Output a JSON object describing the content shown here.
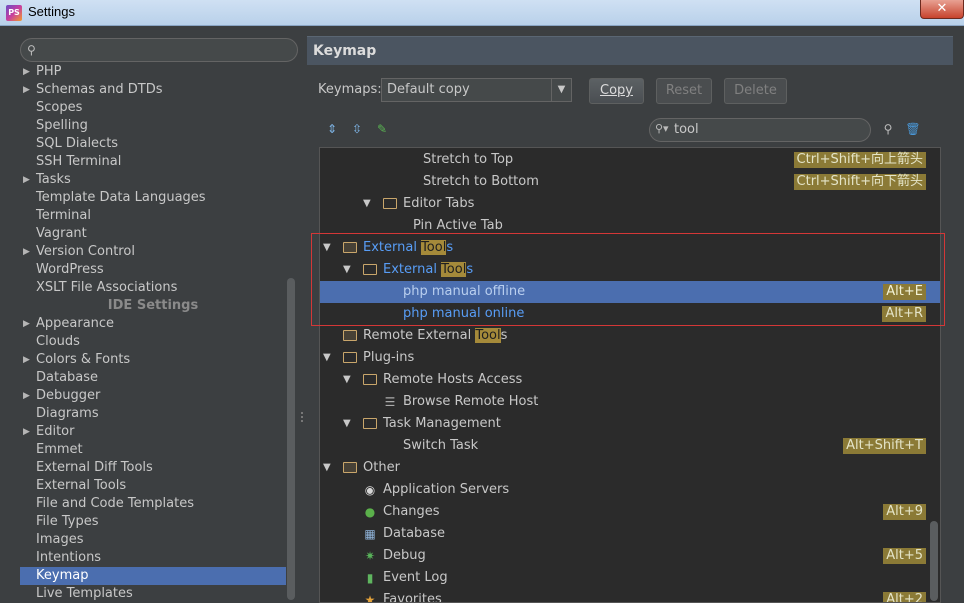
{
  "window": {
    "title": "Settings",
    "app_icon": "PS",
    "close_glyph": "✕"
  },
  "left": {
    "search_placeholder": "",
    "items": [
      {
        "label": "PHP",
        "arrow": "▶"
      },
      {
        "label": "Schemas and DTDs",
        "arrow": "▶"
      },
      {
        "label": "Scopes",
        "arrow": ""
      },
      {
        "label": "Spelling",
        "arrow": ""
      },
      {
        "label": "SQL Dialects",
        "arrow": ""
      },
      {
        "label": "SSH Terminal",
        "arrow": ""
      },
      {
        "label": "Tasks",
        "arrow": "▶"
      },
      {
        "label": "Template Data Languages",
        "arrow": ""
      },
      {
        "label": "Terminal",
        "arrow": ""
      },
      {
        "label": "Vagrant",
        "arrow": ""
      },
      {
        "label": "Version Control",
        "arrow": "▶"
      },
      {
        "label": "WordPress",
        "arrow": ""
      },
      {
        "label": "XSLT File Associations",
        "arrow": ""
      }
    ],
    "group_header": "IDE Settings",
    "ide_items": [
      {
        "label": "Appearance",
        "arrow": "▶"
      },
      {
        "label": "Clouds",
        "arrow": ""
      },
      {
        "label": "Colors & Fonts",
        "arrow": "▶"
      },
      {
        "label": "Database",
        "arrow": ""
      },
      {
        "label": "Debugger",
        "arrow": "▶"
      },
      {
        "label": "Diagrams",
        "arrow": ""
      },
      {
        "label": "Editor",
        "arrow": "▶"
      },
      {
        "label": "Emmet",
        "arrow": ""
      },
      {
        "label": "External Diff Tools",
        "arrow": ""
      },
      {
        "label": "External Tools",
        "arrow": ""
      },
      {
        "label": "File and Code Templates",
        "arrow": ""
      },
      {
        "label": "File Types",
        "arrow": ""
      },
      {
        "label": "Images",
        "arrow": ""
      },
      {
        "label": "Intentions",
        "arrow": ""
      },
      {
        "label": "Keymap",
        "arrow": "",
        "selected": true
      },
      {
        "label": "Live Templates",
        "arrow": ""
      }
    ]
  },
  "right": {
    "header": "Keymap",
    "keymaps_label": "Keymaps:",
    "keymap_value": "Default copy",
    "buttons": {
      "copy": "Copy",
      "reset": "Reset",
      "delete": "Delete"
    },
    "filter_value": "tool",
    "tree": [
      {
        "pre": "Stretch to Top",
        "hl": "",
        "post": "",
        "indent": 3,
        "type": "action",
        "shortcut": "Ctrl+Shift+向上箭头"
      },
      {
        "pre": "Stretch to Bottom",
        "hl": "",
        "post": "",
        "indent": 3,
        "type": "action",
        "shortcut": "Ctrl+Shift+向下箭头"
      },
      {
        "pre": "Editor Tabs",
        "hl": "",
        "post": "",
        "indent": 2,
        "type": "folder",
        "expanded": true,
        "shortcut": ""
      },
      {
        "pre": "Pin Active Tab",
        "hl": "",
        "post": "",
        "indent": 2.5,
        "type": "action",
        "shortcut": ""
      },
      {
        "pre": "External ",
        "hl": "Tool",
        "post": "s",
        "indent": 0,
        "type": "folder-special",
        "expanded": true,
        "shortcut": "",
        "blue": true
      },
      {
        "pre": "External ",
        "hl": "Tool",
        "post": "s",
        "indent": 1,
        "type": "folder",
        "expanded": true,
        "shortcut": "",
        "blue": true
      },
      {
        "pre": "php manual offline",
        "hl": "",
        "post": "",
        "indent": 2,
        "type": "action",
        "shortcut": "Alt+E",
        "selected": true,
        "blue": true
      },
      {
        "pre": "php manual online",
        "hl": "",
        "post": "",
        "indent": 2,
        "type": "action",
        "shortcut": "Alt+R",
        "blue": true
      },
      {
        "pre": "Remote External ",
        "hl": "Tool",
        "post": "s",
        "indent": 0,
        "type": "folder-special",
        "expanded": false,
        "shortcut": ""
      },
      {
        "pre": "Plug-ins",
        "hl": "",
        "post": "",
        "indent": 0,
        "type": "folder",
        "expanded": true,
        "shortcut": ""
      },
      {
        "pre": "Remote Hosts Access",
        "hl": "",
        "post": "",
        "indent": 1,
        "type": "folder",
        "expanded": true,
        "shortcut": ""
      },
      {
        "pre": "Browse Remote Host",
        "hl": "",
        "post": "",
        "indent": 2,
        "type": "doc",
        "shortcut": ""
      },
      {
        "pre": "Task Management",
        "hl": "",
        "post": "",
        "indent": 1,
        "type": "folder",
        "expanded": true,
        "shortcut": ""
      },
      {
        "pre": "Switch Task",
        "hl": "",
        "post": "",
        "indent": 2,
        "type": "action",
        "shortcut": "Alt+Shift+T"
      },
      {
        "pre": "Other",
        "hl": "",
        "post": "",
        "indent": 0,
        "type": "folder-special",
        "expanded": true,
        "shortcut": ""
      },
      {
        "pre": "Application Servers",
        "hl": "",
        "post": "",
        "indent": 1,
        "type": "appservers",
        "shortcut": ""
      },
      {
        "pre": "Changes",
        "hl": "",
        "post": "",
        "indent": 1,
        "type": "changes",
        "shortcut": "Alt+9"
      },
      {
        "pre": "Database",
        "hl": "",
        "post": "",
        "indent": 1,
        "type": "database",
        "shortcut": ""
      },
      {
        "pre": "Debug",
        "hl": "",
        "post": "",
        "indent": 1,
        "type": "debug",
        "shortcut": "Alt+5"
      },
      {
        "pre": "Event Log",
        "hl": "",
        "post": "",
        "indent": 1,
        "type": "eventlog",
        "shortcut": ""
      },
      {
        "pre": "Favorites",
        "hl": "",
        "post": "",
        "indent": 1,
        "type": "favorites",
        "shortcut": "Alt+2"
      }
    ]
  }
}
